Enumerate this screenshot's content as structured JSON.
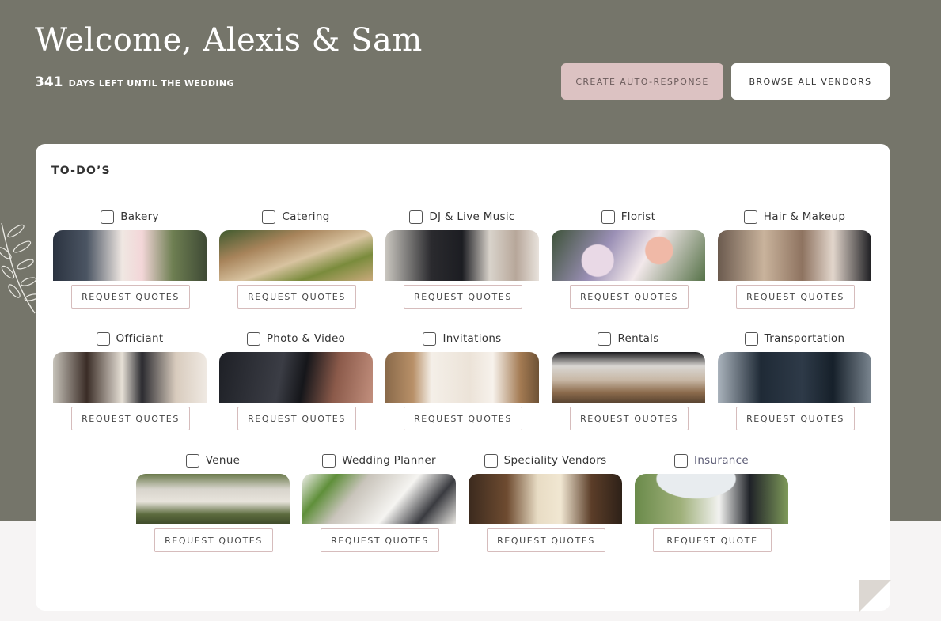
{
  "header": {
    "welcome": "Welcome, Alexis & Sam",
    "days_left": "341",
    "days_text": "DAYS LEFT UNTIL THE WEDDING",
    "btn_auto_response": "CREATE AUTO-RESPONSE",
    "btn_browse_vendors": "BROWSE ALL VENDORS"
  },
  "todos": {
    "title": "TO-DO’S",
    "items": [
      {
        "label": "Bakery",
        "button": "REQUEST QUOTES",
        "checked": false
      },
      {
        "label": "Catering",
        "button": "REQUEST QUOTES",
        "checked": false
      },
      {
        "label": "DJ & Live Music",
        "button": "REQUEST QUOTES",
        "checked": false
      },
      {
        "label": "Florist",
        "button": "REQUEST QUOTES",
        "checked": false
      },
      {
        "label": "Hair & Makeup",
        "button": "REQUEST QUOTES",
        "checked": false
      },
      {
        "label": "Officiant",
        "button": "REQUEST QUOTES",
        "checked": false
      },
      {
        "label": "Photo & Video",
        "button": "REQUEST QUOTES",
        "checked": false
      },
      {
        "label": "Invitations",
        "button": "REQUEST QUOTES",
        "checked": false
      },
      {
        "label": "Rentals",
        "button": "REQUEST QUOTES",
        "checked": false
      },
      {
        "label": "Transportation",
        "button": "REQUEST QUOTES",
        "checked": false
      },
      {
        "label": "Venue",
        "button": "REQUEST QUOTES",
        "checked": false
      },
      {
        "label": "Wedding Planner",
        "button": "REQUEST QUOTES",
        "checked": false
      },
      {
        "label": "Speciality Vendors",
        "button": "REQUEST QUOTES",
        "checked": false
      },
      {
        "label": "Insurance",
        "button": "REQUEST QUOTE",
        "checked": false
      }
    ]
  },
  "colors": {
    "header_bg": "#75756a",
    "accent_pink": "#dcc2c2",
    "button_border": "#d6bcbc"
  }
}
